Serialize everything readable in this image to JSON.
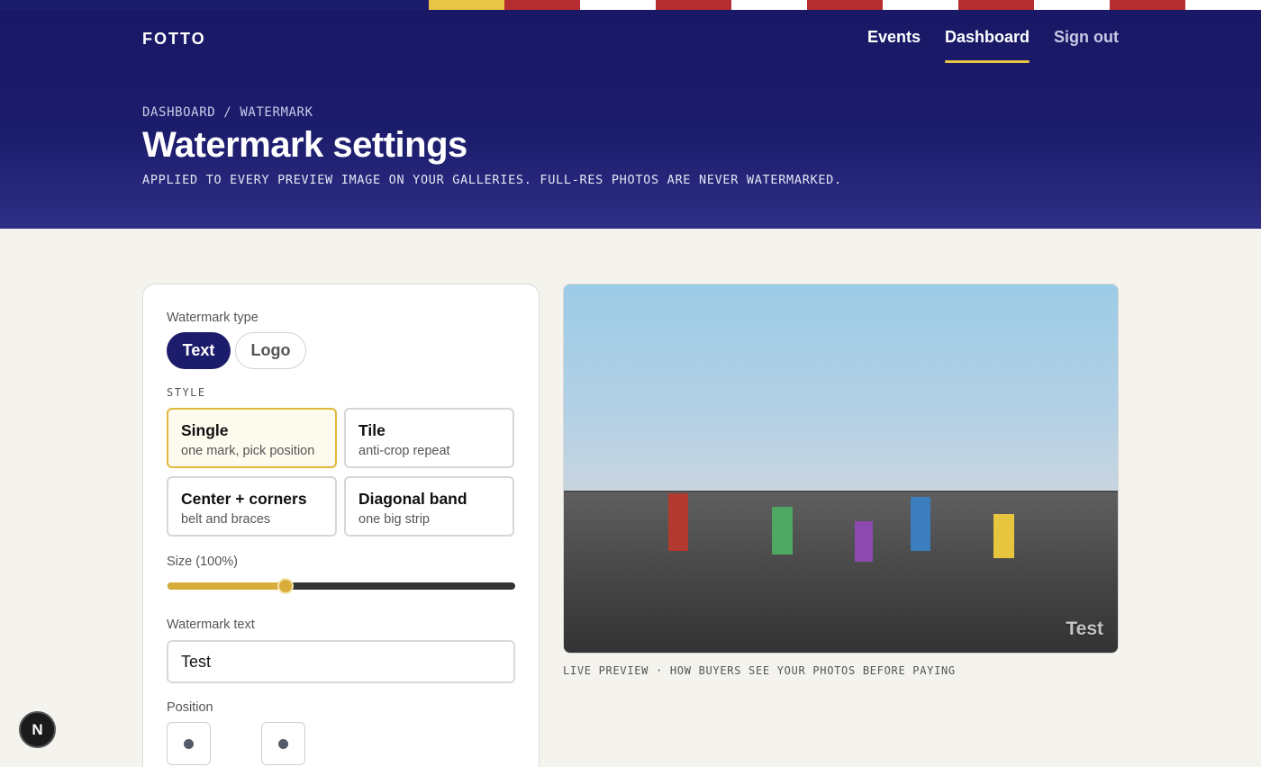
{
  "flag_strip": {
    "colors": [
      "#1c1c6c",
      "#e9c545",
      "#b52d30",
      "#ffffff",
      "#b52d30",
      "#ffffff",
      "#b52d30",
      "#ffffff",
      "#b52d30",
      "#ffffff",
      "#b52d30",
      "#ffffff"
    ]
  },
  "header": {
    "brand": "FOTTO",
    "nav": [
      {
        "label": "Events",
        "active": false
      },
      {
        "label": "Dashboard",
        "active": true
      },
      {
        "label": "Sign out",
        "active": false
      }
    ],
    "breadcrumb": "DASHBOARD / WATERMARK",
    "title": "Watermark settings",
    "subtitle": "APPLIED TO EVERY PREVIEW IMAGE ON YOUR GALLERIES. FULL-RES PHOTOS ARE NEVER WATERMARKED."
  },
  "settings": {
    "type_label": "Watermark type",
    "type_options": [
      "Text",
      "Logo"
    ],
    "type_selected": "Text",
    "style_label": "STYLE",
    "styles": [
      {
        "title": "Single",
        "sub": "one mark, pick position",
        "selected": true
      },
      {
        "title": "Tile",
        "sub": "anti-crop repeat",
        "selected": false
      },
      {
        "title": "Center + corners",
        "sub": "belt and braces",
        "selected": false
      },
      {
        "title": "Diagonal band",
        "sub": "one big strip",
        "selected": false
      }
    ],
    "size_label": "Size (100%)",
    "size_fraction": 0.34,
    "text_label": "Watermark text",
    "text_value": "Test",
    "position_label": "Position"
  },
  "preview": {
    "watermark_text": "Test",
    "caption": "LIVE PREVIEW · HOW BUYERS SEE YOUR PHOTOS BEFORE PAYING",
    "bar_colors": [
      "#b23a30",
      "#4fa862",
      "#8c49b0",
      "#3b7dbd",
      "#e7c53e"
    ]
  },
  "dev_badge": "N",
  "colors": {
    "brand_navy": "#1c1c6c",
    "accent_gold": "#e0b83c"
  }
}
